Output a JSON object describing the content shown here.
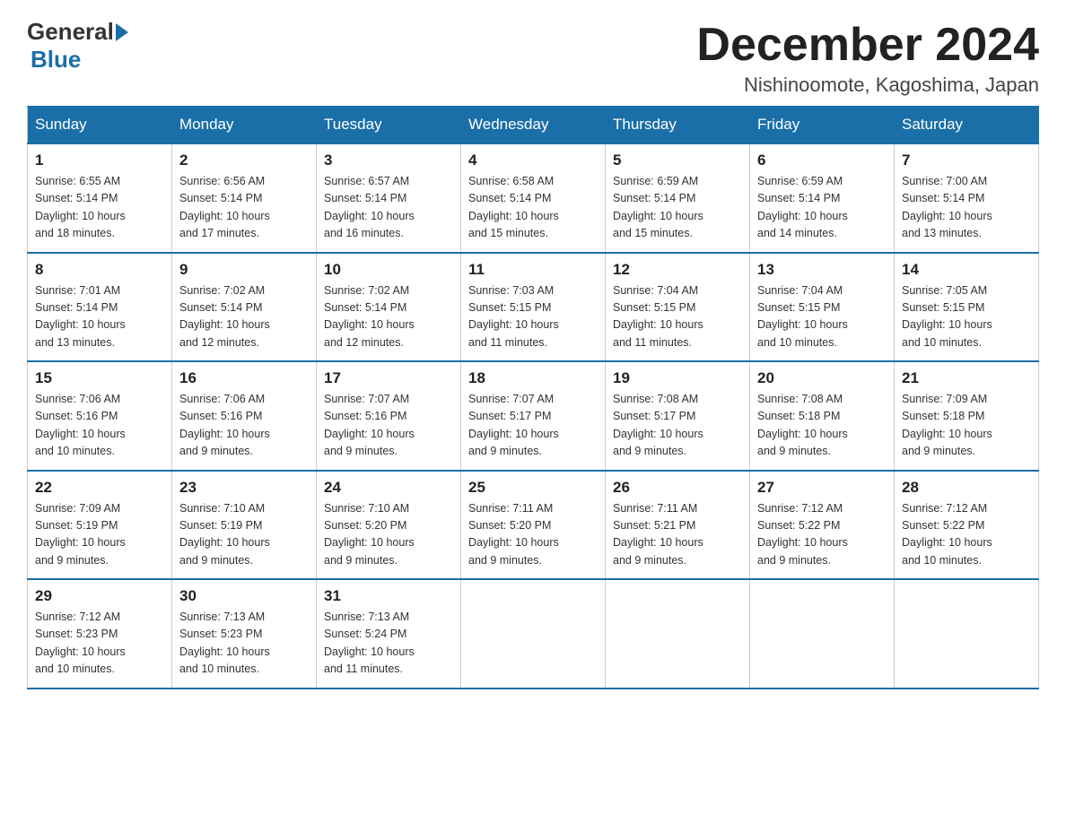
{
  "header": {
    "logo_general": "General",
    "logo_blue": "Blue",
    "month_title": "December 2024",
    "location": "Nishinoomote, Kagoshima, Japan"
  },
  "days_of_week": [
    "Sunday",
    "Monday",
    "Tuesday",
    "Wednesday",
    "Thursday",
    "Friday",
    "Saturday"
  ],
  "weeks": [
    [
      {
        "day": "1",
        "sunrise": "6:55 AM",
        "sunset": "5:14 PM",
        "daylight": "10 hours and 18 minutes."
      },
      {
        "day": "2",
        "sunrise": "6:56 AM",
        "sunset": "5:14 PM",
        "daylight": "10 hours and 17 minutes."
      },
      {
        "day": "3",
        "sunrise": "6:57 AM",
        "sunset": "5:14 PM",
        "daylight": "10 hours and 16 minutes."
      },
      {
        "day": "4",
        "sunrise": "6:58 AM",
        "sunset": "5:14 PM",
        "daylight": "10 hours and 15 minutes."
      },
      {
        "day": "5",
        "sunrise": "6:59 AM",
        "sunset": "5:14 PM",
        "daylight": "10 hours and 15 minutes."
      },
      {
        "day": "6",
        "sunrise": "6:59 AM",
        "sunset": "5:14 PM",
        "daylight": "10 hours and 14 minutes."
      },
      {
        "day": "7",
        "sunrise": "7:00 AM",
        "sunset": "5:14 PM",
        "daylight": "10 hours and 13 minutes."
      }
    ],
    [
      {
        "day": "8",
        "sunrise": "7:01 AM",
        "sunset": "5:14 PM",
        "daylight": "10 hours and 13 minutes."
      },
      {
        "day": "9",
        "sunrise": "7:02 AM",
        "sunset": "5:14 PM",
        "daylight": "10 hours and 12 minutes."
      },
      {
        "day": "10",
        "sunrise": "7:02 AM",
        "sunset": "5:14 PM",
        "daylight": "10 hours and 12 minutes."
      },
      {
        "day": "11",
        "sunrise": "7:03 AM",
        "sunset": "5:15 PM",
        "daylight": "10 hours and 11 minutes."
      },
      {
        "day": "12",
        "sunrise": "7:04 AM",
        "sunset": "5:15 PM",
        "daylight": "10 hours and 11 minutes."
      },
      {
        "day": "13",
        "sunrise": "7:04 AM",
        "sunset": "5:15 PM",
        "daylight": "10 hours and 10 minutes."
      },
      {
        "day": "14",
        "sunrise": "7:05 AM",
        "sunset": "5:15 PM",
        "daylight": "10 hours and 10 minutes."
      }
    ],
    [
      {
        "day": "15",
        "sunrise": "7:06 AM",
        "sunset": "5:16 PM",
        "daylight": "10 hours and 10 minutes."
      },
      {
        "day": "16",
        "sunrise": "7:06 AM",
        "sunset": "5:16 PM",
        "daylight": "10 hours and 9 minutes."
      },
      {
        "day": "17",
        "sunrise": "7:07 AM",
        "sunset": "5:16 PM",
        "daylight": "10 hours and 9 minutes."
      },
      {
        "day": "18",
        "sunrise": "7:07 AM",
        "sunset": "5:17 PM",
        "daylight": "10 hours and 9 minutes."
      },
      {
        "day": "19",
        "sunrise": "7:08 AM",
        "sunset": "5:17 PM",
        "daylight": "10 hours and 9 minutes."
      },
      {
        "day": "20",
        "sunrise": "7:08 AM",
        "sunset": "5:18 PM",
        "daylight": "10 hours and 9 minutes."
      },
      {
        "day": "21",
        "sunrise": "7:09 AM",
        "sunset": "5:18 PM",
        "daylight": "10 hours and 9 minutes."
      }
    ],
    [
      {
        "day": "22",
        "sunrise": "7:09 AM",
        "sunset": "5:19 PM",
        "daylight": "10 hours and 9 minutes."
      },
      {
        "day": "23",
        "sunrise": "7:10 AM",
        "sunset": "5:19 PM",
        "daylight": "10 hours and 9 minutes."
      },
      {
        "day": "24",
        "sunrise": "7:10 AM",
        "sunset": "5:20 PM",
        "daylight": "10 hours and 9 minutes."
      },
      {
        "day": "25",
        "sunrise": "7:11 AM",
        "sunset": "5:20 PM",
        "daylight": "10 hours and 9 minutes."
      },
      {
        "day": "26",
        "sunrise": "7:11 AM",
        "sunset": "5:21 PM",
        "daylight": "10 hours and 9 minutes."
      },
      {
        "day": "27",
        "sunrise": "7:12 AM",
        "sunset": "5:22 PM",
        "daylight": "10 hours and 9 minutes."
      },
      {
        "day": "28",
        "sunrise": "7:12 AM",
        "sunset": "5:22 PM",
        "daylight": "10 hours and 10 minutes."
      }
    ],
    [
      {
        "day": "29",
        "sunrise": "7:12 AM",
        "sunset": "5:23 PM",
        "daylight": "10 hours and 10 minutes."
      },
      {
        "day": "30",
        "sunrise": "7:13 AM",
        "sunset": "5:23 PM",
        "daylight": "10 hours and 10 minutes."
      },
      {
        "day": "31",
        "sunrise": "7:13 AM",
        "sunset": "5:24 PM",
        "daylight": "10 hours and 11 minutes."
      },
      null,
      null,
      null,
      null
    ]
  ],
  "labels": {
    "sunrise": "Sunrise:",
    "sunset": "Sunset:",
    "daylight": "Daylight:"
  }
}
